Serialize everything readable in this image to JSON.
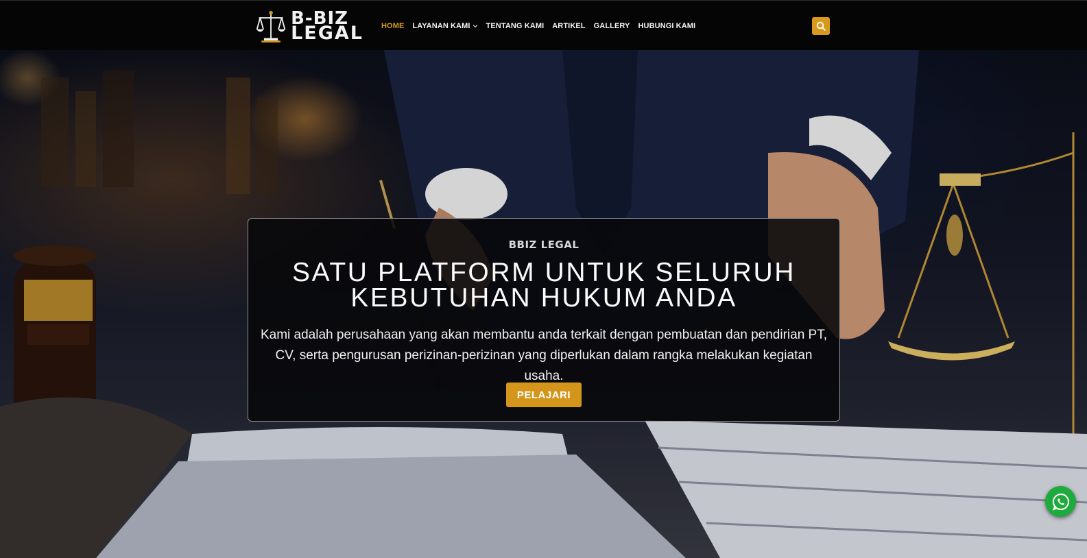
{
  "brand": {
    "logo_line1": "B-BIZ",
    "logo_line2": "LEGAL"
  },
  "nav": {
    "items": [
      {
        "label": "HOME",
        "active": true
      },
      {
        "label": "LAYANAN KAMI",
        "dropdown": true
      },
      {
        "label": "TENTANG KAMI"
      },
      {
        "label": "ARTIKEL"
      },
      {
        "label": "GALLERY"
      },
      {
        "label": "HUBUNGI KAMI"
      }
    ],
    "search_icon": "search-icon"
  },
  "hero": {
    "eyebrow": "BBIZ LEGAL",
    "headline": "SATU PLATFORM UNTUK SELURUH KEBUTUHAN HUKUM ANDA",
    "lead": "Kami adalah perusahaan yang akan membantu anda terkait dengan pembuatan dan pendirian PT, CV, serta pengurusan perizinan-perizinan yang diperlukan dalam rangka melakukan kegiatan usaha.",
    "cta_label": "PELAJARI"
  },
  "floating": {
    "whatsapp_icon": "whatsapp-icon"
  },
  "colors": {
    "accent": "#d4951b",
    "header_bg": "#050505",
    "whatsapp": "#1faa3e"
  }
}
